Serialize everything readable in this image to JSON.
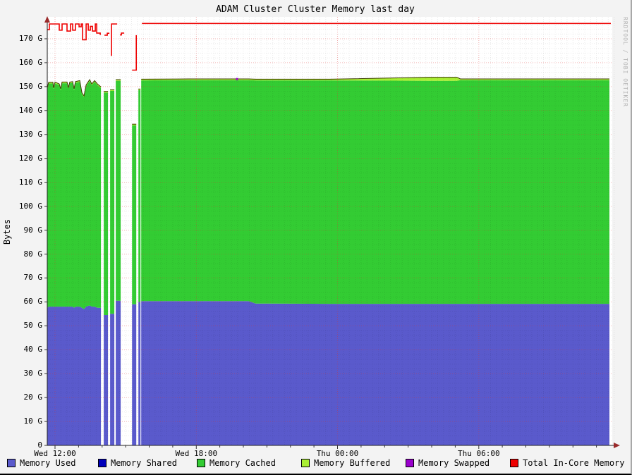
{
  "chart_data": {
    "type": "area",
    "title": "ADAM Cluster Cluster Memory last day",
    "ylabel": "Bytes",
    "watermark": "RRDTOOL / TOBI OETIKER",
    "unit": "G",
    "ylim": [
      0,
      177
    ],
    "y_major_step": 10,
    "y_minor_step": 2,
    "x_span_hours": 24,
    "grid": "dotted",
    "legend_position": "bottom",
    "yticks": [
      {
        "v": 0,
        "label": "0"
      },
      {
        "v": 10,
        "label": "10 G"
      },
      {
        "v": 20,
        "label": "20 G"
      },
      {
        "v": 30,
        "label": "30 G"
      },
      {
        "v": 40,
        "label": "40 G"
      },
      {
        "v": 50,
        "label": "50 G"
      },
      {
        "v": 60,
        "label": "60 G"
      },
      {
        "v": 70,
        "label": "70 G"
      },
      {
        "v": 80,
        "label": "80 G"
      },
      {
        "v": 90,
        "label": "90 G"
      },
      {
        "v": 100,
        "label": "100 G"
      },
      {
        "v": 110,
        "label": "110 G"
      },
      {
        "v": 120,
        "label": "120 G"
      },
      {
        "v": 130,
        "label": "130 G"
      },
      {
        "v": 140,
        "label": "140 G"
      },
      {
        "v": 150,
        "label": "150 G"
      },
      {
        "v": 160,
        "label": "160 G"
      },
      {
        "v": 170,
        "label": "170 G"
      }
    ],
    "xticks": [
      {
        "h": 0.33,
        "label": "Wed 12:00"
      },
      {
        "h": 6.33,
        "label": "Wed 18:00"
      },
      {
        "h": 12.33,
        "label": "Thu 00:00"
      },
      {
        "h": 18.33,
        "label": "Thu 06:00"
      }
    ],
    "colors": {
      "used": "#5a5acc",
      "shared": "#0000bb",
      "cached": "#33cc33",
      "buffered": "#aaee33",
      "swapped": "#9900cc",
      "total": "#ee0000",
      "cap": "#3a3a00",
      "grid_minor": "rgba(0,0,0,0.08)",
      "grid_major": "rgba(215,50,50,0.38)"
    },
    "legend": [
      {
        "label": "Memory Used",
        "color": "#5a5acc"
      },
      {
        "label": "Memory Shared",
        "color": "#0000bb"
      },
      {
        "label": "Memory Cached",
        "color": "#33cc33"
      },
      {
        "label": "Memory Buffered",
        "color": "#aaee33"
      },
      {
        "label": "Memory Swapped",
        "color": "#9900cc"
      },
      {
        "label": "Total In-Core Memory",
        "color": "#ee0000"
      }
    ],
    "series_note": "segments = contiguous stacked-area runs; points are [hours_from_start, used_top_G, cached_top_G, optional buffered_top_G]; white gaps between segments are missing data",
    "segments": [
      {
        "points": [
          [
            0.0,
            57.5,
            149.0
          ],
          [
            0.06,
            58,
            151.3
          ],
          [
            0.24,
            58,
            151.3
          ],
          [
            0.27,
            58,
            149.0
          ],
          [
            0.33,
            58,
            151.4
          ],
          [
            0.51,
            58,
            150.6
          ],
          [
            0.57,
            58,
            148.6
          ],
          [
            0.63,
            58,
            151.4
          ],
          [
            0.84,
            58,
            151.4
          ],
          [
            0.9,
            58,
            149.2
          ],
          [
            0.96,
            58,
            151.4
          ],
          [
            1.08,
            58,
            151.6
          ],
          [
            1.14,
            57.5,
            148.6
          ],
          [
            1.2,
            58,
            151.6
          ],
          [
            1.38,
            58,
            152.0
          ],
          [
            1.47,
            57.5,
            147.0
          ],
          [
            1.56,
            57,
            145.6
          ],
          [
            1.65,
            58,
            150.2
          ],
          [
            1.8,
            58.5,
            152.4
          ],
          [
            1.89,
            58,
            150.6
          ],
          [
            2.01,
            58,
            152.0
          ],
          [
            2.13,
            57.5,
            150.6
          ],
          [
            2.28,
            57.5,
            149.4
          ]
        ]
      },
      {
        "points": [
          [
            2.4,
            54.5,
            147.5
          ],
          [
            2.58,
            54.5,
            147.5
          ]
        ]
      },
      {
        "points": [
          [
            2.67,
            55,
            148.2
          ],
          [
            2.85,
            55,
            148.2
          ]
        ]
      },
      {
        "points": [
          [
            2.91,
            60.5,
            152.4
          ],
          [
            3.12,
            60.5,
            152.4
          ]
        ]
      },
      {
        "points": [
          [
            3.6,
            59,
            133.8
          ],
          [
            3.78,
            59,
            133.8
          ]
        ]
      },
      {
        "points": [
          [
            3.87,
            60,
            148.5
          ],
          [
            3.96,
            60,
            148.5
          ]
        ]
      },
      {
        "points": [
          [
            3.99,
            60.3,
            152.6
          ],
          [
            6.0,
            60.3,
            152.7
          ],
          [
            8.55,
            60.3,
            152.7
          ],
          [
            8.85,
            59.3,
            152.6
          ],
          [
            12.0,
            59.2,
            152.6
          ],
          [
            16.2,
            59.2,
            152.4,
            153.9
          ],
          [
            17.4,
            59.2,
            152.4,
            153.9
          ],
          [
            17.55,
            59.2,
            152.7
          ],
          [
            20.0,
            59.2,
            152.7
          ],
          [
            23.88,
            59.2,
            152.7
          ]
        ]
      }
    ],
    "total_line_segments": [
      [
        [
          0.0,
          173.8
        ],
        [
          0.09,
          173.8
        ],
        [
          0.09,
          176.2
        ],
        [
          0.51,
          176.2
        ],
        [
          0.51,
          173.6
        ],
        [
          0.63,
          173.6
        ],
        [
          0.63,
          176.2
        ],
        [
          0.84,
          176.2
        ],
        [
          0.84,
          173.2
        ],
        [
          0.99,
          173.2
        ],
        [
          0.99,
          176.2
        ],
        [
          1.08,
          176.2
        ],
        [
          1.08,
          173.6
        ],
        [
          1.2,
          173.6
        ],
        [
          1.2,
          176.2
        ],
        [
          1.35,
          176.2
        ],
        [
          1.35,
          175.0
        ],
        [
          1.44,
          175.0
        ],
        [
          1.44,
          176.2
        ],
        [
          1.5,
          176.2
        ],
        [
          1.5,
          169.6
        ],
        [
          1.65,
          169.6
        ],
        [
          1.65,
          176.2
        ],
        [
          1.74,
          176.2
        ],
        [
          1.74,
          173.6
        ],
        [
          1.83,
          173.6
        ],
        [
          1.83,
          175.2
        ],
        [
          1.92,
          175.2
        ],
        [
          1.92,
          173.2
        ],
        [
          2.04,
          173.2
        ],
        [
          2.04,
          176.2
        ],
        [
          2.1,
          176.2
        ],
        [
          2.1,
          172.4
        ],
        [
          2.25,
          172.4
        ],
        [
          2.25,
          171.6
        ]
      ],
      [
        [
          2.43,
          171.5
        ],
        [
          2.55,
          171.5
        ],
        [
          2.55,
          172.3
        ],
        [
          2.64,
          172.3
        ]
      ],
      [
        [
          2.73,
          162.8
        ],
        [
          2.73,
          176.2
        ],
        [
          2.97,
          176.2
        ]
      ],
      [
        [
          3.09,
          171.6
        ],
        [
          3.15,
          171.6
        ],
        [
          3.15,
          172.4
        ],
        [
          3.27,
          172.4
        ]
      ],
      [
        [
          3.6,
          156.9
        ],
        [
          3.78,
          156.9
        ],
        [
          3.78,
          171.5
        ]
      ],
      [
        [
          4.02,
          176.4
        ],
        [
          23.94,
          176.4
        ]
      ]
    ],
    "swapped_dots": [
      [
        8.06,
        153.3
      ]
    ]
  }
}
